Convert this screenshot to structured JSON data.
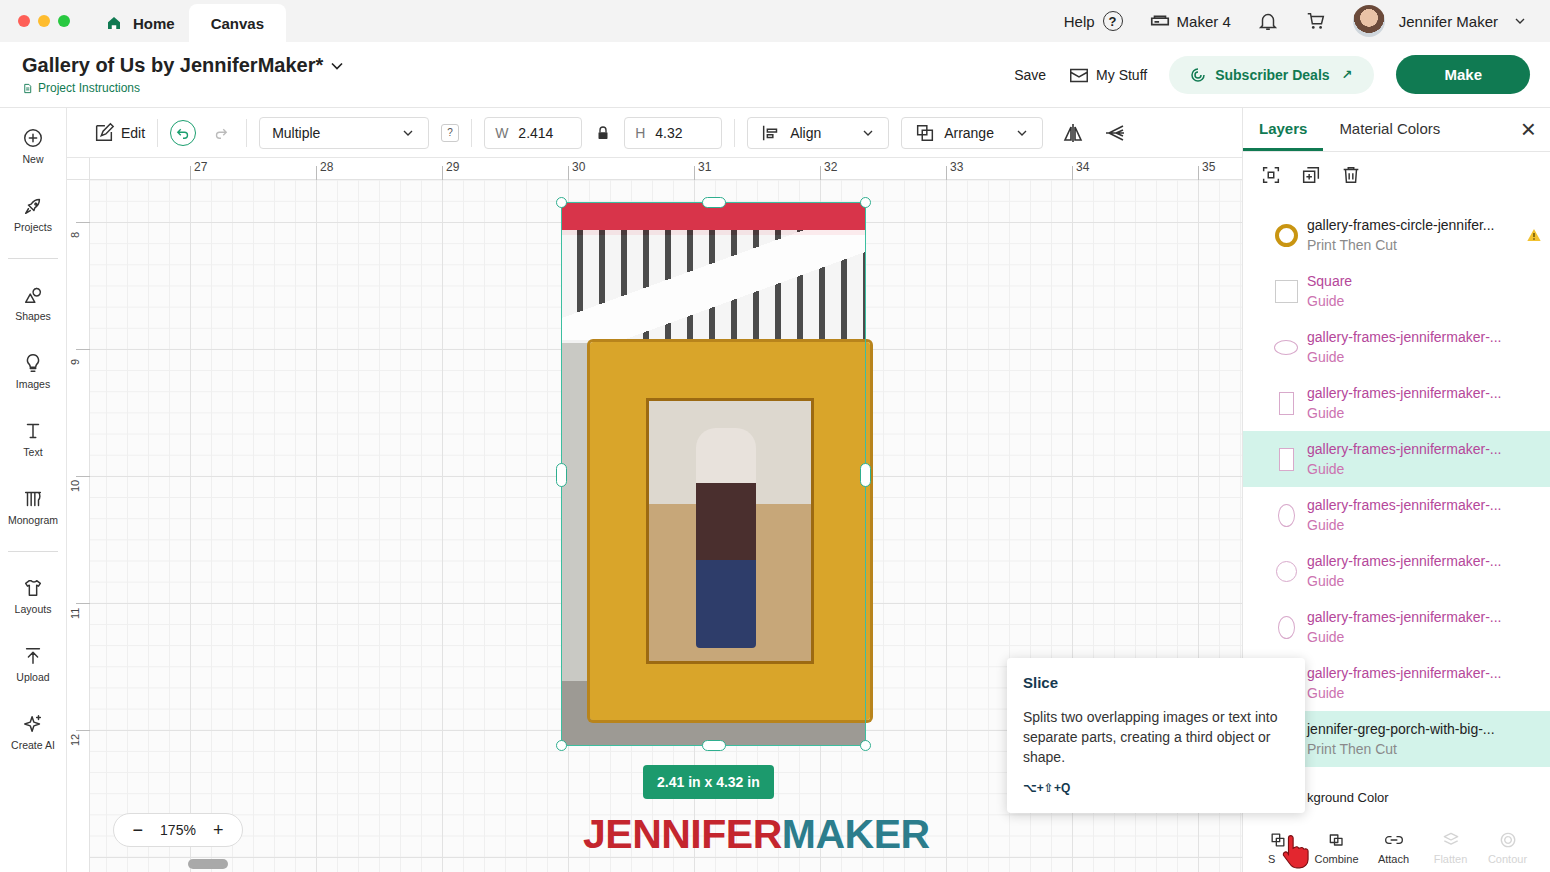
{
  "window": {
    "traffic_lights": [
      {
        "color": "#fe5f57"
      },
      {
        "color": "#febc2e"
      },
      {
        "color": "#28c840"
      }
    ]
  },
  "top_tabs": [
    {
      "label": "Home",
      "selected": false
    },
    {
      "label": "Canvas",
      "selected": true
    }
  ],
  "top_right": {
    "help": "Help",
    "help_icon": "?",
    "machine": "Maker 4",
    "user": "Jennifer Maker"
  },
  "project": {
    "title": "Gallery of Us by JenniferMaker*",
    "instructions": "Project Instructions"
  },
  "header_actions": {
    "save": "Save",
    "my_stuff": "My Stuff",
    "deals": "Subscriber Deals",
    "deals_icon": "↗",
    "make": "Make"
  },
  "sidebar": {
    "groups": [
      [
        {
          "label": "New"
        },
        {
          "label": "Projects"
        }
      ],
      [
        {
          "label": "Shapes"
        },
        {
          "label": "Images"
        },
        {
          "label": "Text"
        },
        {
          "label": "Monogram"
        }
      ],
      [
        {
          "label": "Layouts"
        },
        {
          "label": "Upload"
        },
        {
          "label": "Create AI"
        }
      ]
    ]
  },
  "toolbar": {
    "edit": "Edit",
    "undo_enabled": true,
    "redo_enabled": false,
    "operation": "Multiple",
    "operation_help": "?",
    "width_label": "W",
    "width": "2.414",
    "locked": true,
    "height_label": "H",
    "height": "4.32",
    "align": "Align",
    "arrange": "Arrange"
  },
  "rulers": {
    "horizontal": [
      "27",
      "28",
      "29",
      "30",
      "31",
      "32",
      "33",
      "34",
      "35"
    ],
    "vertical": [
      "8",
      "9",
      "10",
      "11",
      "12"
    ]
  },
  "selection": {
    "size": "2.41 in x 4.32 in"
  },
  "zoom": {
    "minus": "−",
    "value": "175%",
    "plus": "+"
  },
  "watermark": {
    "first": "JENNIFER",
    "second": "MAKER"
  },
  "panel": {
    "tabs": [
      {
        "label": "Layers",
        "selected": true
      },
      {
        "label": "Material Colors",
        "selected": false
      }
    ],
    "close": "×"
  },
  "layers": [
    {
      "name": "gallery-frames-circle-jennifer...",
      "type": "Print Then Cut",
      "kind": "ring",
      "guide": false,
      "selected": false,
      "warning": true
    },
    {
      "name": "Square",
      "type": "Guide",
      "kind": "square",
      "guide": true,
      "selected": false,
      "warning": false
    },
    {
      "name": "gallery-frames-jennifermaker-...",
      "type": "Guide",
      "kind": "oval-wide",
      "guide": true,
      "selected": false,
      "warning": false
    },
    {
      "name": "gallery-frames-jennifermaker-...",
      "type": "Guide",
      "kind": "rect-tall",
      "guide": true,
      "selected": false,
      "warning": false
    },
    {
      "name": "gallery-frames-jennifermaker-...",
      "type": "Guide",
      "kind": "rect-tall",
      "guide": true,
      "selected": true,
      "warning": false
    },
    {
      "name": "gallery-frames-jennifermaker-...",
      "type": "Guide",
      "kind": "oval-tall",
      "guide": true,
      "selected": false,
      "warning": false
    },
    {
      "name": "gallery-frames-jennifermaker-...",
      "type": "Guide",
      "kind": "circle",
      "guide": true,
      "selected": false,
      "warning": false
    },
    {
      "name": "gallery-frames-jennifermaker-...",
      "type": "Guide",
      "kind": "oval-tall",
      "guide": true,
      "selected": false,
      "warning": false
    },
    {
      "name": "gallery-frames-jennifermaker-...",
      "type": "Guide",
      "kind": "circle",
      "guide": true,
      "selected": false,
      "warning": false
    },
    {
      "name": "jennifer-greg-porch-with-big-...",
      "type": "Print Then Cut",
      "kind": "photo",
      "guide": false,
      "selected": true,
      "warning": false
    }
  ],
  "background_row": {
    "label": "kground Color"
  },
  "actions": [
    {
      "kind": "slice",
      "label": "S",
      "disabled": false
    },
    {
      "kind": "combine",
      "label": "Combine",
      "disabled": false
    },
    {
      "kind": "attach",
      "label": "Attach",
      "disabled": false
    },
    {
      "kind": "flatten",
      "label": "Flatten",
      "disabled": true
    },
    {
      "kind": "contour",
      "label": "Contour",
      "disabled": true
    }
  ],
  "tooltip": {
    "title": "Slice",
    "text": "Splits two overlapping images or text into separate parts, creating a third object or shape.",
    "shortcut": "⌥+⇧+Q"
  }
}
